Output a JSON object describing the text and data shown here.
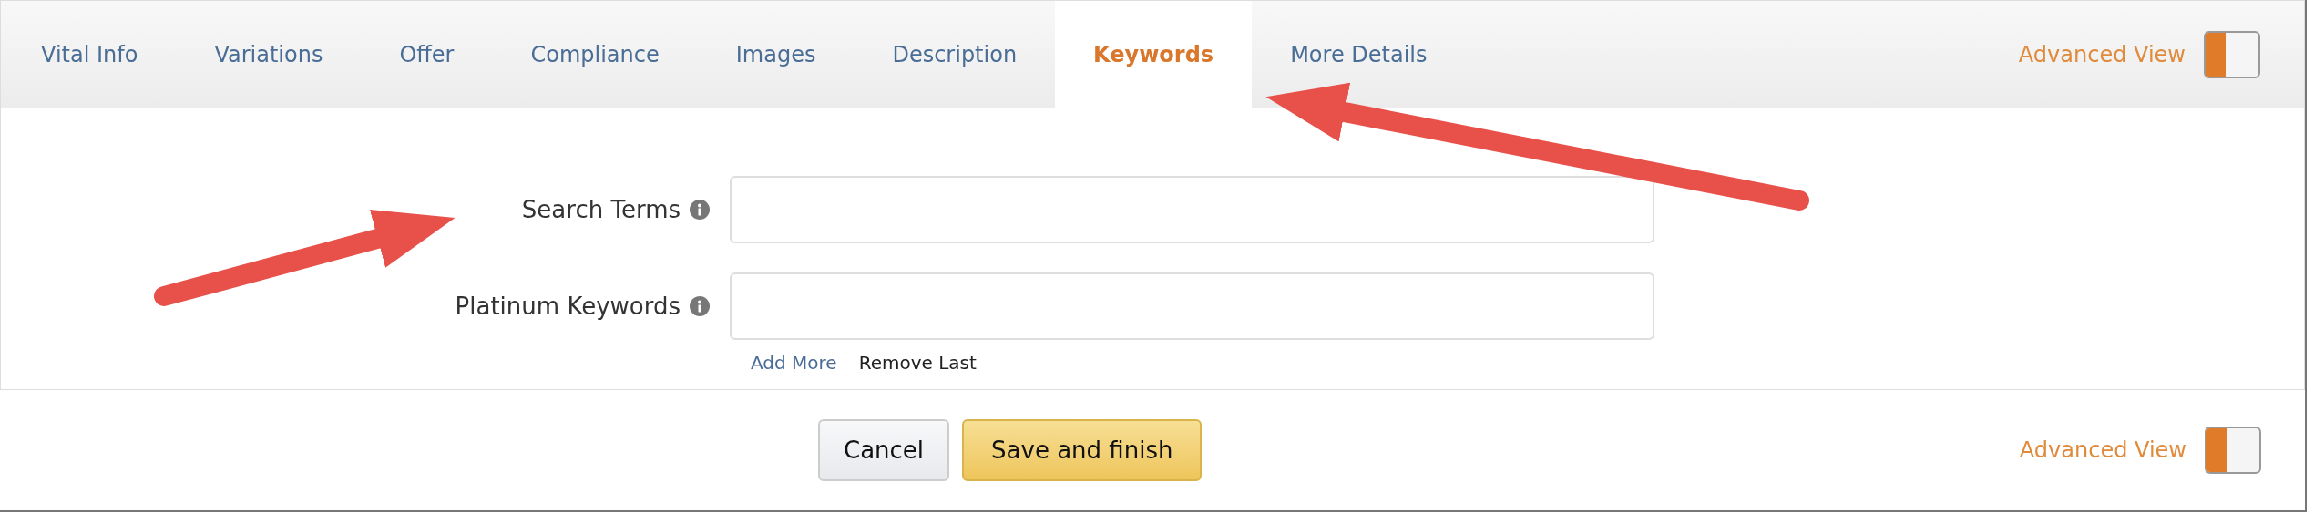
{
  "tabs": [
    {
      "label": "Vital Info",
      "selected": false
    },
    {
      "label": "Variations",
      "selected": false
    },
    {
      "label": "Offer",
      "selected": false
    },
    {
      "label": "Compliance",
      "selected": false
    },
    {
      "label": "Images",
      "selected": false
    },
    {
      "label": "Description",
      "selected": false
    },
    {
      "label": "Keywords",
      "selected": true
    },
    {
      "label": "More Details",
      "selected": false
    }
  ],
  "advanced_view_top": {
    "label": "Advanced View",
    "on": true
  },
  "fields": [
    {
      "label": "Search Terms"
    },
    {
      "label": "Platinum Keywords"
    }
  ],
  "field_links": [
    {
      "label": "Add More",
      "kind": "link"
    },
    {
      "label": "Remove Last",
      "kind": "plain"
    }
  ],
  "buttons": [
    {
      "label": "Cancel",
      "kind": "secondary"
    },
    {
      "label": "Save and finish",
      "kind": "primary"
    }
  ],
  "advanced_view_bottom": {
    "label": "Advanced View",
    "on": true
  }
}
